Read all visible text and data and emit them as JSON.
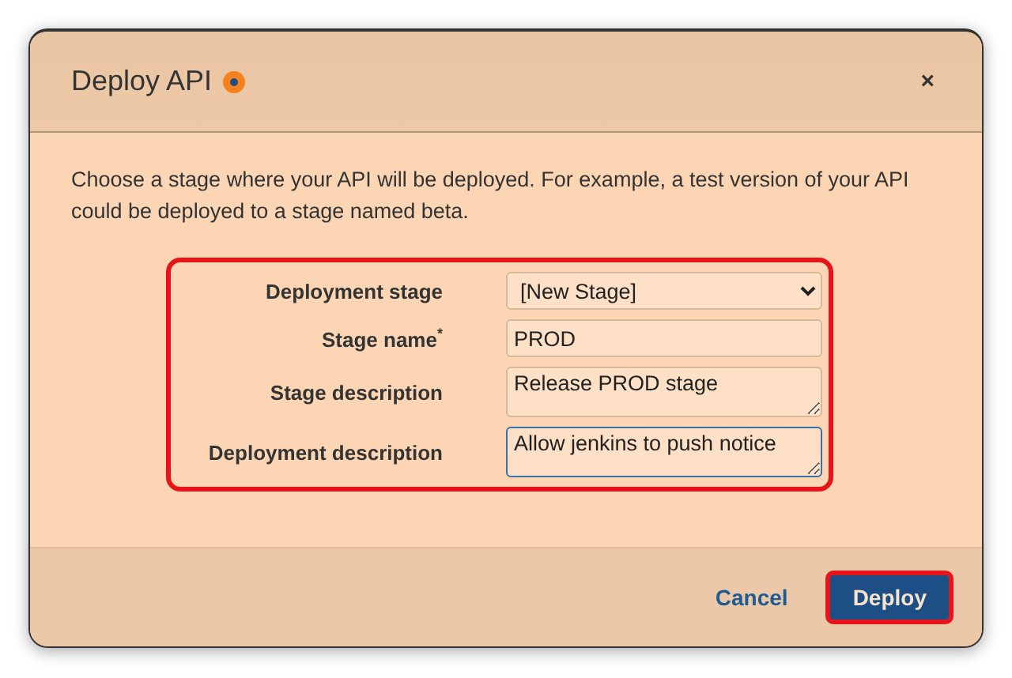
{
  "dialog": {
    "title": "Deploy API",
    "close": "×",
    "intro": "Choose a stage where your API will be deployed. For example, a test version of your API could be deployed to a stage named beta."
  },
  "form": {
    "highlighted": true,
    "fields": [
      {
        "kind": "select",
        "label": "Deployment stage",
        "value": "[New Stage]",
        "focused": false
      },
      {
        "kind": "input",
        "label": "Stage name",
        "required_mark": "*",
        "value": "PROD",
        "focused": false
      },
      {
        "kind": "textarea",
        "label": "Stage description",
        "value": "Release PROD stage",
        "focused": false
      },
      {
        "kind": "textarea",
        "label": "Deployment description",
        "value": "Allow jenkins to push notice",
        "focused": true
      }
    ]
  },
  "buttons": [
    {
      "kind": "link",
      "label": "Cancel",
      "highlighted": false
    },
    {
      "kind": "primary",
      "label": "Deploy",
      "highlighted": true
    }
  ]
}
